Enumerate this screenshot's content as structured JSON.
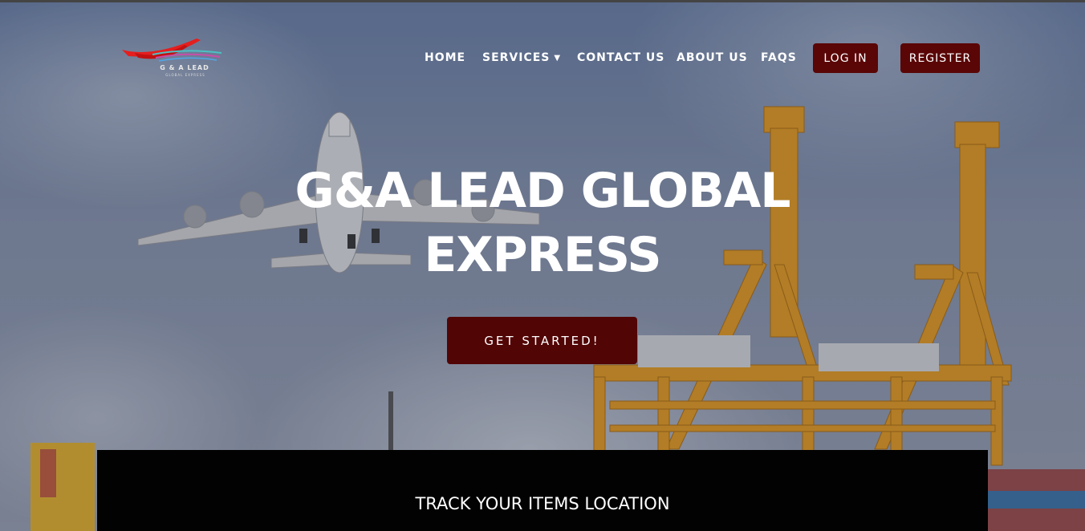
{
  "logo": {
    "name": "G & A LEAD",
    "tagline": "GLOBAL EXPRESS"
  },
  "nav": {
    "home": "HOME",
    "services": "SERVICES",
    "contact": "CONTACT US",
    "about": "ABOUT US",
    "faqs": "FAQS",
    "login": "LOG IN",
    "register": "REGISTER"
  },
  "hero": {
    "title_line1": "G&A LEAD GLOBAL",
    "title_line2": "EXPRESS",
    "cta": "GET STARTED!"
  },
  "track": {
    "title": "TRACK YOUR ITEMS LOCATION"
  },
  "colors": {
    "brand": "#520505",
    "accent_crane": "#e89b1c",
    "track_bg": "#020202"
  },
  "icons": {
    "services_dropdown": "chevron-down-icon"
  }
}
